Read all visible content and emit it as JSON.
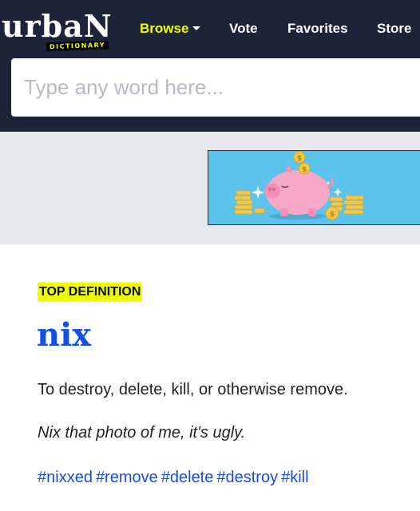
{
  "brand": {
    "logo_main": "urbaN",
    "logo_sub": "DICTIONARY"
  },
  "nav": {
    "browse": "Browse",
    "vote": "Vote",
    "favorites": "Favorites",
    "store": "Store"
  },
  "search": {
    "placeholder": "Type any word here..."
  },
  "colors": {
    "header_bg": "#1d2439",
    "accent_yellow": "#efff00",
    "link_blue": "#134fe6",
    "ad_band_bg": "#e8e9ec",
    "ad_bg": "#5bc3ec"
  },
  "definition": {
    "badge": "TOP DEFINITION",
    "word": "nix",
    "meaning": "To destroy, delete, kill, or otherwise remove.",
    "example": "Nix that photo of me, it's ugly.",
    "tags": [
      "#nixxed",
      "#remove",
      "#delete",
      "#destroy",
      "#kill"
    ]
  }
}
